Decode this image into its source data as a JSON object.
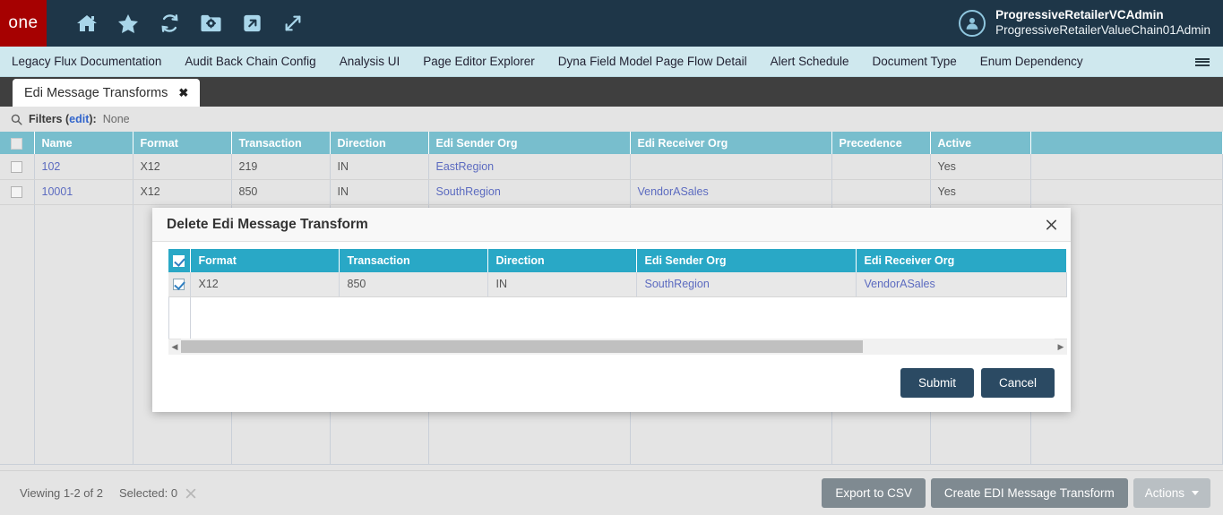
{
  "topbar": {
    "logo_text": "one",
    "tools": [
      {
        "name": "home-icon",
        "label": "Home"
      },
      {
        "name": "star-icon",
        "label": "Favorites"
      },
      {
        "name": "refresh-icon",
        "label": "Refresh"
      },
      {
        "name": "folder-gear-icon",
        "label": "Manage"
      },
      {
        "name": "open-external-icon",
        "label": "Open"
      },
      {
        "name": "expand-icon",
        "label": "Expand"
      }
    ],
    "user": {
      "primary": "ProgressiveRetailerVCAdmin",
      "secondary": "ProgressiveRetailerValueChain01Admin",
      "avatar_icon": "user-avatar-icon"
    }
  },
  "nav": {
    "items": [
      {
        "label": "Legacy Flux Documentation"
      },
      {
        "label": "Audit Back Chain Config"
      },
      {
        "label": "Analysis UI"
      },
      {
        "label": "Page Editor Explorer"
      },
      {
        "label": "Dyna Field Model Page Flow Detail"
      },
      {
        "label": "Alert Schedule"
      },
      {
        "label": "Document Type"
      },
      {
        "label": "Enum Dependency"
      }
    ],
    "menu_icon": "hamburger-menu-icon"
  },
  "tab": {
    "label": "Edi Message Transforms",
    "close_glyph": "✖"
  },
  "filters": {
    "search_icon": "search-icon",
    "label": "Filters (",
    "edit_label": "edit",
    "label_end": "):",
    "value": "None"
  },
  "grid": {
    "columns": [
      "Name",
      "Format",
      "Transaction",
      "Direction",
      "Edi Sender Org",
      "Edi Receiver Org",
      "Precedence",
      "Active",
      ""
    ],
    "rows": [
      {
        "name": "102",
        "format": "X12",
        "transaction": "219",
        "direction": "IN",
        "sender": "EastRegion",
        "receiver": "",
        "precedence": "",
        "active": "Yes"
      },
      {
        "name": "10001",
        "format": "X12",
        "transaction": "850",
        "direction": "IN",
        "sender": "SouthRegion",
        "receiver": "VendorASales",
        "precedence": "",
        "active": "Yes"
      }
    ]
  },
  "modal": {
    "title": "Delete Edi Message Transform",
    "close_glyph": "✕",
    "columns": [
      "Format",
      "Transaction",
      "Direction",
      "Edi Sender Org",
      "Edi Receiver Org"
    ],
    "rows": [
      {
        "format": "X12",
        "transaction": "850",
        "direction": "IN",
        "sender": "SouthRegion",
        "receiver": "VendorASales",
        "checked": true
      }
    ],
    "header_checked": true,
    "scroll_left_glyph": "◀",
    "scroll_right_glyph": "▶",
    "submit_label": "Submit",
    "cancel_label": "Cancel"
  },
  "footer": {
    "viewing": "Viewing 1-2 of 2",
    "selected": "Selected: 0",
    "clear_icon": "clear-selection-icon",
    "export_label": "Export to CSV",
    "create_label": "Create EDI Message Transform",
    "actions_label": "Actions"
  },
  "colors": {
    "brand_red": "#a60101",
    "topbar_navy": "#1e3648",
    "nav_teal": "#cfe8ee",
    "grid_header_teal": "#78becd",
    "modal_header_teal": "#29a8c6",
    "button_navy": "#2b4a63",
    "link_blue": "#5c6bc0"
  }
}
